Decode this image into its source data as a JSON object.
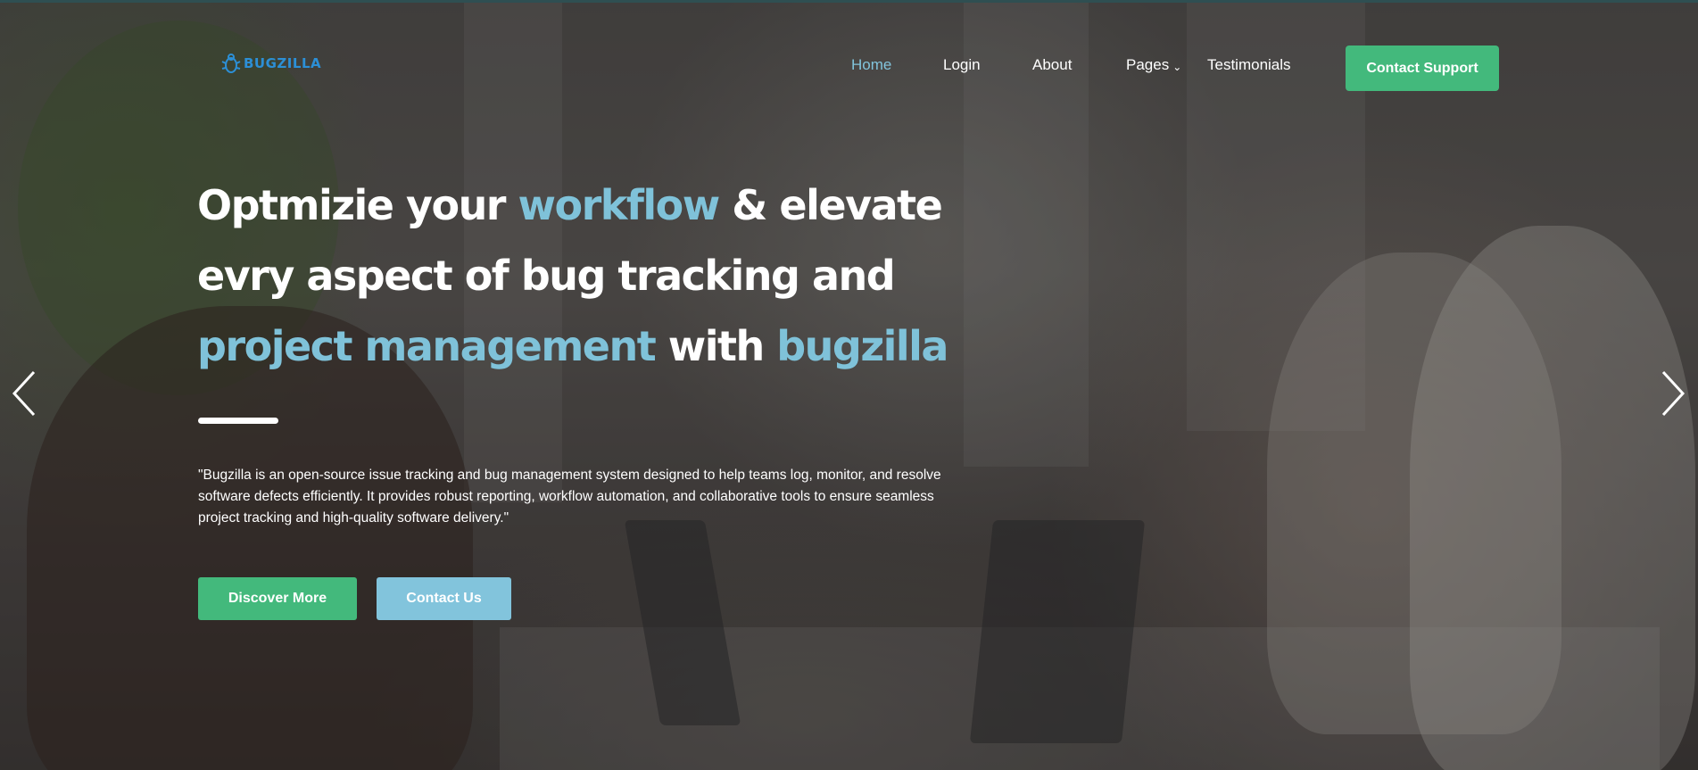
{
  "brand": {
    "name": "BUGZILLA",
    "color": "#2c8fd6"
  },
  "nav": {
    "items": [
      {
        "label": "Home",
        "active": true
      },
      {
        "label": "Login"
      },
      {
        "label": "About"
      },
      {
        "label": "Pages",
        "has_dropdown": true,
        "dropdown_icon": "chevron-down-icon"
      },
      {
        "label": "Testimonials"
      }
    ],
    "cta_label": "Contact Support"
  },
  "hero": {
    "headline": {
      "p1": "Optmizie your ",
      "h1": "workflow",
      "p2": " & elevate evry aspect of bug tracking and ",
      "h2": "project management",
      "p3": " with ",
      "h3": "bugzilla"
    },
    "description": "\"Bugzilla is an open-source issue tracking and bug management system designed to help teams log, monitor, and resolve software defects efficiently. It provides robust reporting, workflow automation, and collaborative tools to ensure seamless project tracking and high-quality software delivery.\"",
    "primary_button": "Discover More",
    "secondary_button": "Contact Us"
  },
  "carousel": {
    "prev_icon": "chevron-left-icon",
    "next_icon": "chevron-right-icon"
  },
  "colors": {
    "accent_green": "#43b97c",
    "accent_blue": "#82c4dc",
    "text": "#ffffff"
  }
}
